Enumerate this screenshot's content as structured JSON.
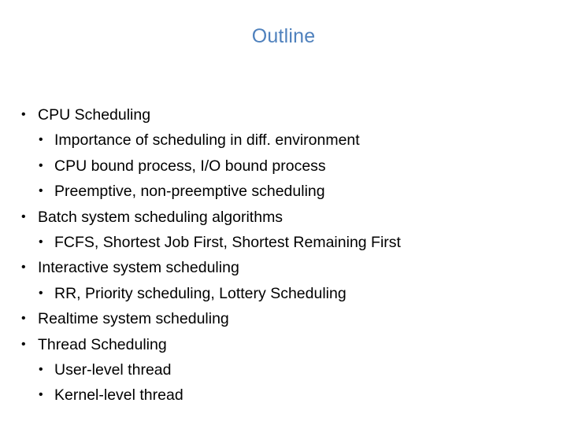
{
  "slide": {
    "title": "Outline",
    "title_color": "#4f81bd",
    "bullet_glyph": "•",
    "items": [
      {
        "level": 1,
        "text": "CPU Scheduling"
      },
      {
        "level": 2,
        "text": "Importance of scheduling in diff. environment"
      },
      {
        "level": 2,
        "text": "CPU bound process, I/O bound process"
      },
      {
        "level": 2,
        "text": "Preemptive, non-preemptive scheduling"
      },
      {
        "level": 1,
        "text": "Batch system scheduling algorithms"
      },
      {
        "level": 2,
        "text": "FCFS, Shortest Job First, Shortest Remaining First"
      },
      {
        "level": 1,
        "text": "Interactive system scheduling"
      },
      {
        "level": 2,
        "text": "RR, Priority scheduling, Lottery Scheduling"
      },
      {
        "level": 1,
        "text": "Realtime system scheduling"
      },
      {
        "level": 1,
        "text": "Thread Scheduling"
      },
      {
        "level": 2,
        "text": "User-level thread"
      },
      {
        "level": 2,
        "text": "Kernel-level thread"
      }
    ]
  }
}
